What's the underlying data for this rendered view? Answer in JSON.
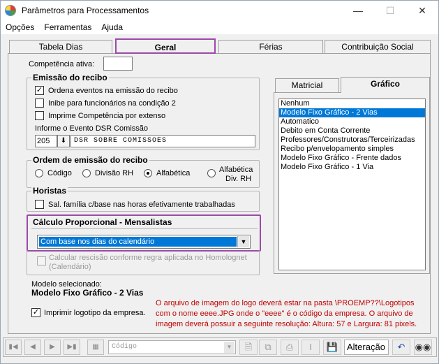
{
  "window": {
    "title": "Parâmetros para Processamentos",
    "minimize_icon": "minimize-icon",
    "maximize_icon": "maximize-icon",
    "close_icon": "close-icon"
  },
  "menu": {
    "opcoes": "Opções",
    "ferramentas": "Ferramentas",
    "ajuda": "Ajuda"
  },
  "tabs": {
    "tabela_dias": "Tabela Dias",
    "geral": "Geral",
    "ferias": "Férias",
    "contribuicao": "Contribuição Social"
  },
  "competencia": {
    "label": "Competência ativa:",
    "value": ""
  },
  "emissao": {
    "title": "Emissão do recibo",
    "ordena": "Ordena eventos na emissão do recibo",
    "inibe": "Inibe para funcionários na condição 2",
    "imprime": "Imprime Competência por extenso",
    "dsr_label": "Informe o Evento DSR Comissão",
    "dsr_code": "205",
    "dsr_desc": "DSR SOBRE COMISSOES"
  },
  "ordem": {
    "title": "Ordem de emissão do recibo",
    "codigo": "Código",
    "divisao": "Divisão RH",
    "alfabetica": "Alfabética",
    "alfabetica_div_line1": "Alfabética",
    "alfabetica_div_line2": "Div. RH"
  },
  "horistas": {
    "title": "Horistas",
    "sal_familia": "Sal. família c/base nas horas efetivamente trabalhadas"
  },
  "calculo": {
    "title": "Cálculo Proporcional - Mensalistas",
    "combo_value": "Com base nos dias do calendário",
    "rescisao_line1": "Calcular rescisão conforme regra aplicada no Homolognet",
    "rescisao_line2": "(Calendário)"
  },
  "modelo": {
    "label": "Modelo selecionado:",
    "value": "Modelo Fixo Gráfico - 2 Vias"
  },
  "logo": {
    "imprimir": "Imprimir logotipo da empresa."
  },
  "note": {
    "text": "O arquivo de imagem do logo deverá estar na pasta \\PROEMP??\\Logotipos com o nome eeee.JPG onde o \"eeee\" é o código da empresa. O arquivo de imagem deverá possuir a seguinte resolução: Altura: 57 e Largura: 81 pixels."
  },
  "subtabs": {
    "matricial": "Matricial",
    "grafico": "Gráfico"
  },
  "list": {
    "items": [
      "Nenhum",
      "Modelo Fixo Gráfico - 2 Vias",
      "Automatico",
      "Debito em Conta Corrente",
      "Professores/Construtoras/Terceirizadas",
      "Recibo p/envelopamento simples",
      "Modelo Fixo Gráfico - Frente dados",
      "Modelo Fixo Gráfico - 1 Via"
    ],
    "selected_index": 1
  },
  "bottombar": {
    "codigo_placeholder": "Código",
    "mode": "Alteração"
  },
  "colors": {
    "highlight": "#9b4aa8",
    "selection": "#0078d7",
    "note": "#c00000"
  }
}
